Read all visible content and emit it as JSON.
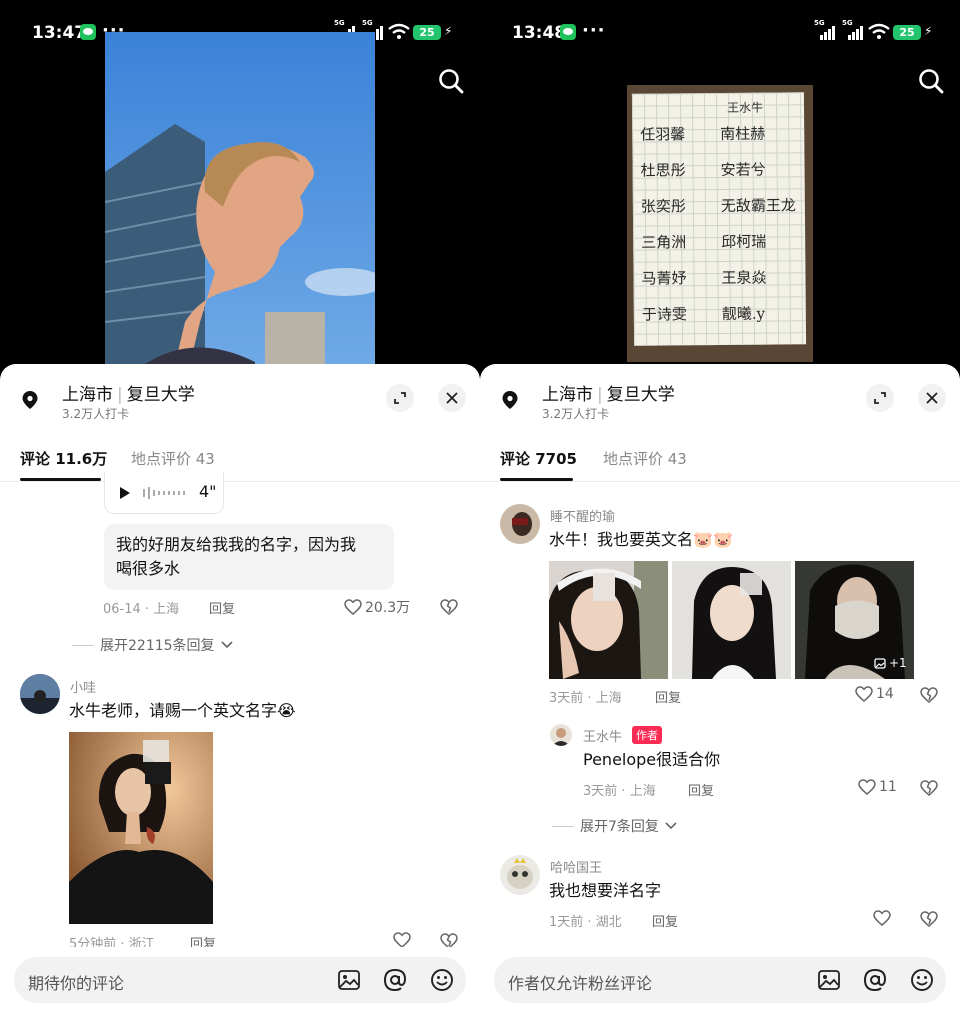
{
  "colors": {
    "wechat_green": "#1fc25c",
    "battery_green": "#22c56e",
    "author_badge": "#fe2c55"
  },
  "left": {
    "status": {
      "time": "13:47",
      "signal1": "5G",
      "signal2": "5G",
      "battery": "25"
    },
    "location": {
      "city": "上海市",
      "place": "复旦大学",
      "checkins": "3.2万人打卡"
    },
    "tabs": [
      {
        "label": "评论 11.6万"
      },
      {
        "label": "地点评价 43"
      }
    ],
    "voice_duration": "4\"",
    "comment1": {
      "text_line1": "我的好朋友给我我的名字，因为我",
      "text_line2": "喝很多水",
      "meta": "06-14 · 上海",
      "reply": "回复",
      "likes": "20.3万"
    },
    "expand": "展开22115条回复",
    "comment2": {
      "user": "小哇",
      "text": "水牛老师，请赐一个英文名字",
      "emoji": "😭",
      "meta": "5分钟前 · 浙江",
      "reply": "回复"
    },
    "input_placeholder": "期待你的评论",
    "icons": [
      "search-icon",
      "location-pin-icon",
      "expand-icon",
      "close-icon",
      "play-icon",
      "heart-icon",
      "dislike-icon",
      "chevron-down-icon",
      "image-icon",
      "at-icon",
      "emoji-icon"
    ]
  },
  "right": {
    "status": {
      "time": "13:48",
      "signal1": "5G",
      "signal2": "5G",
      "battery": "25"
    },
    "paper": {
      "header": "王水牛",
      "names": [
        "任羽馨",
        "南柱赫",
        "杜思彤",
        "安若兮",
        "张奕彤",
        "无敌霸王龙",
        "三角洲",
        "邱柯瑞",
        "马菁妤",
        "王泉焱",
        "于诗雯",
        "靓曦.y"
      ]
    },
    "location": {
      "city": "上海市",
      "place": "复旦大学",
      "checkins": "3.2万人打卡"
    },
    "tabs": [
      {
        "label": "评论 7705"
      },
      {
        "label": "地点评价 43"
      }
    ],
    "comment1": {
      "user": "睡不醒的瑜",
      "text": "水牛！我也要英文名",
      "emoji": "🐷🐷",
      "more_photos": "+1",
      "meta": "3天前 · 上海",
      "reply": "回复",
      "likes": "14"
    },
    "reply1": {
      "user": "王水牛",
      "badge": "作者",
      "text": "Penelope很适合你",
      "meta": "3天前 · 上海",
      "reply": "回复",
      "likes": "11"
    },
    "expand": "展开7条回复",
    "comment2": {
      "user": "哈哈国王",
      "text": "我也想要洋名字",
      "meta": "1天前 · 湖北",
      "reply": "回复"
    },
    "input_placeholder": "作者仅允许粉丝评论"
  }
}
